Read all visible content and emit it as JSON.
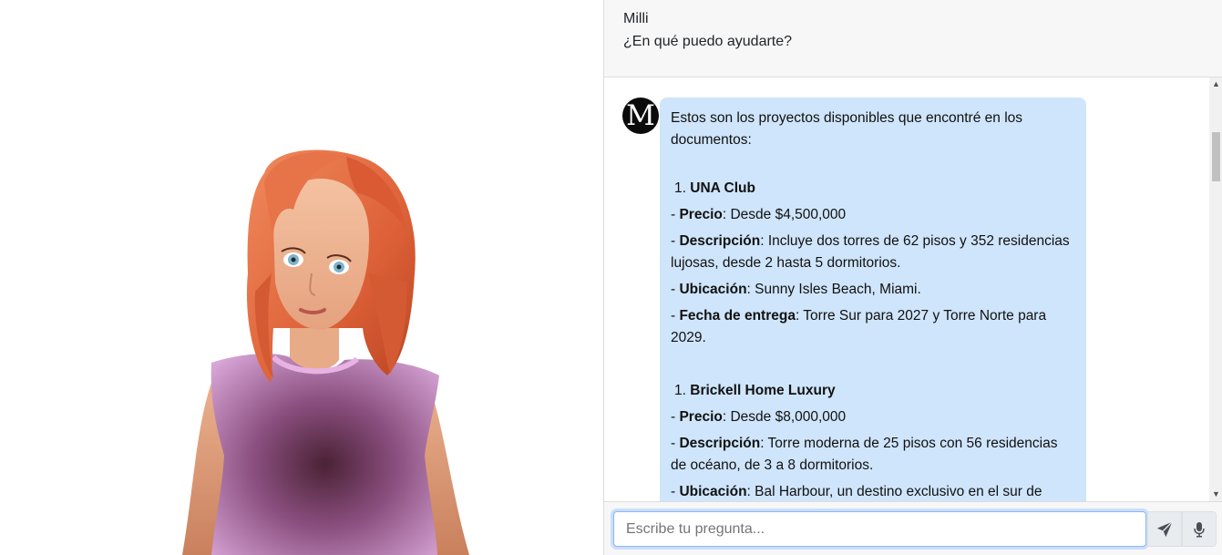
{
  "header": {
    "name": "Milli",
    "subtitle": "¿En qué puedo ayudarte?"
  },
  "bot": {
    "avatar_letter": "M"
  },
  "message": {
    "intro": "Estos son los proyectos disponibles que encontré en los documentos:",
    "projects": [
      {
        "number": "1.",
        "title": "UNA Club",
        "fields": [
          {
            "label": "Precio",
            "value": ": Desde $4,500,000"
          },
          {
            "label": "Descripción",
            "value": ": Incluye dos torres de 62 pisos y 352 residencias lujosas, desde 2 hasta 5 dormitorios."
          },
          {
            "label": "Ubicación",
            "value": ": Sunny Isles Beach, Miami."
          },
          {
            "label": "Fecha de entrega",
            "value": ": Torre Sur para 2027 y Torre Norte para 2029."
          }
        ]
      },
      {
        "number": "1.",
        "title": "Brickell Home Luxury",
        "fields": [
          {
            "label": "Precio",
            "value": ": Desde $8,000,000"
          },
          {
            "label": "Descripción",
            "value": ": Torre moderna de 25 pisos con 56 residencias de océano, de 3 a 8 dormitorios."
          },
          {
            "label": "Ubicación",
            "value": ": Bal Harbour, un destino exclusivo en el sur de"
          }
        ]
      }
    ]
  },
  "input": {
    "placeholder": "Escribe tu pregunta..."
  },
  "icons": {
    "send": "send-icon",
    "mic": "microphone-icon"
  },
  "colors": {
    "bubble": "#cfe5fb",
    "header_bg": "#f7f7f7",
    "hair": "#e06a43",
    "top": "#c98ac6"
  }
}
